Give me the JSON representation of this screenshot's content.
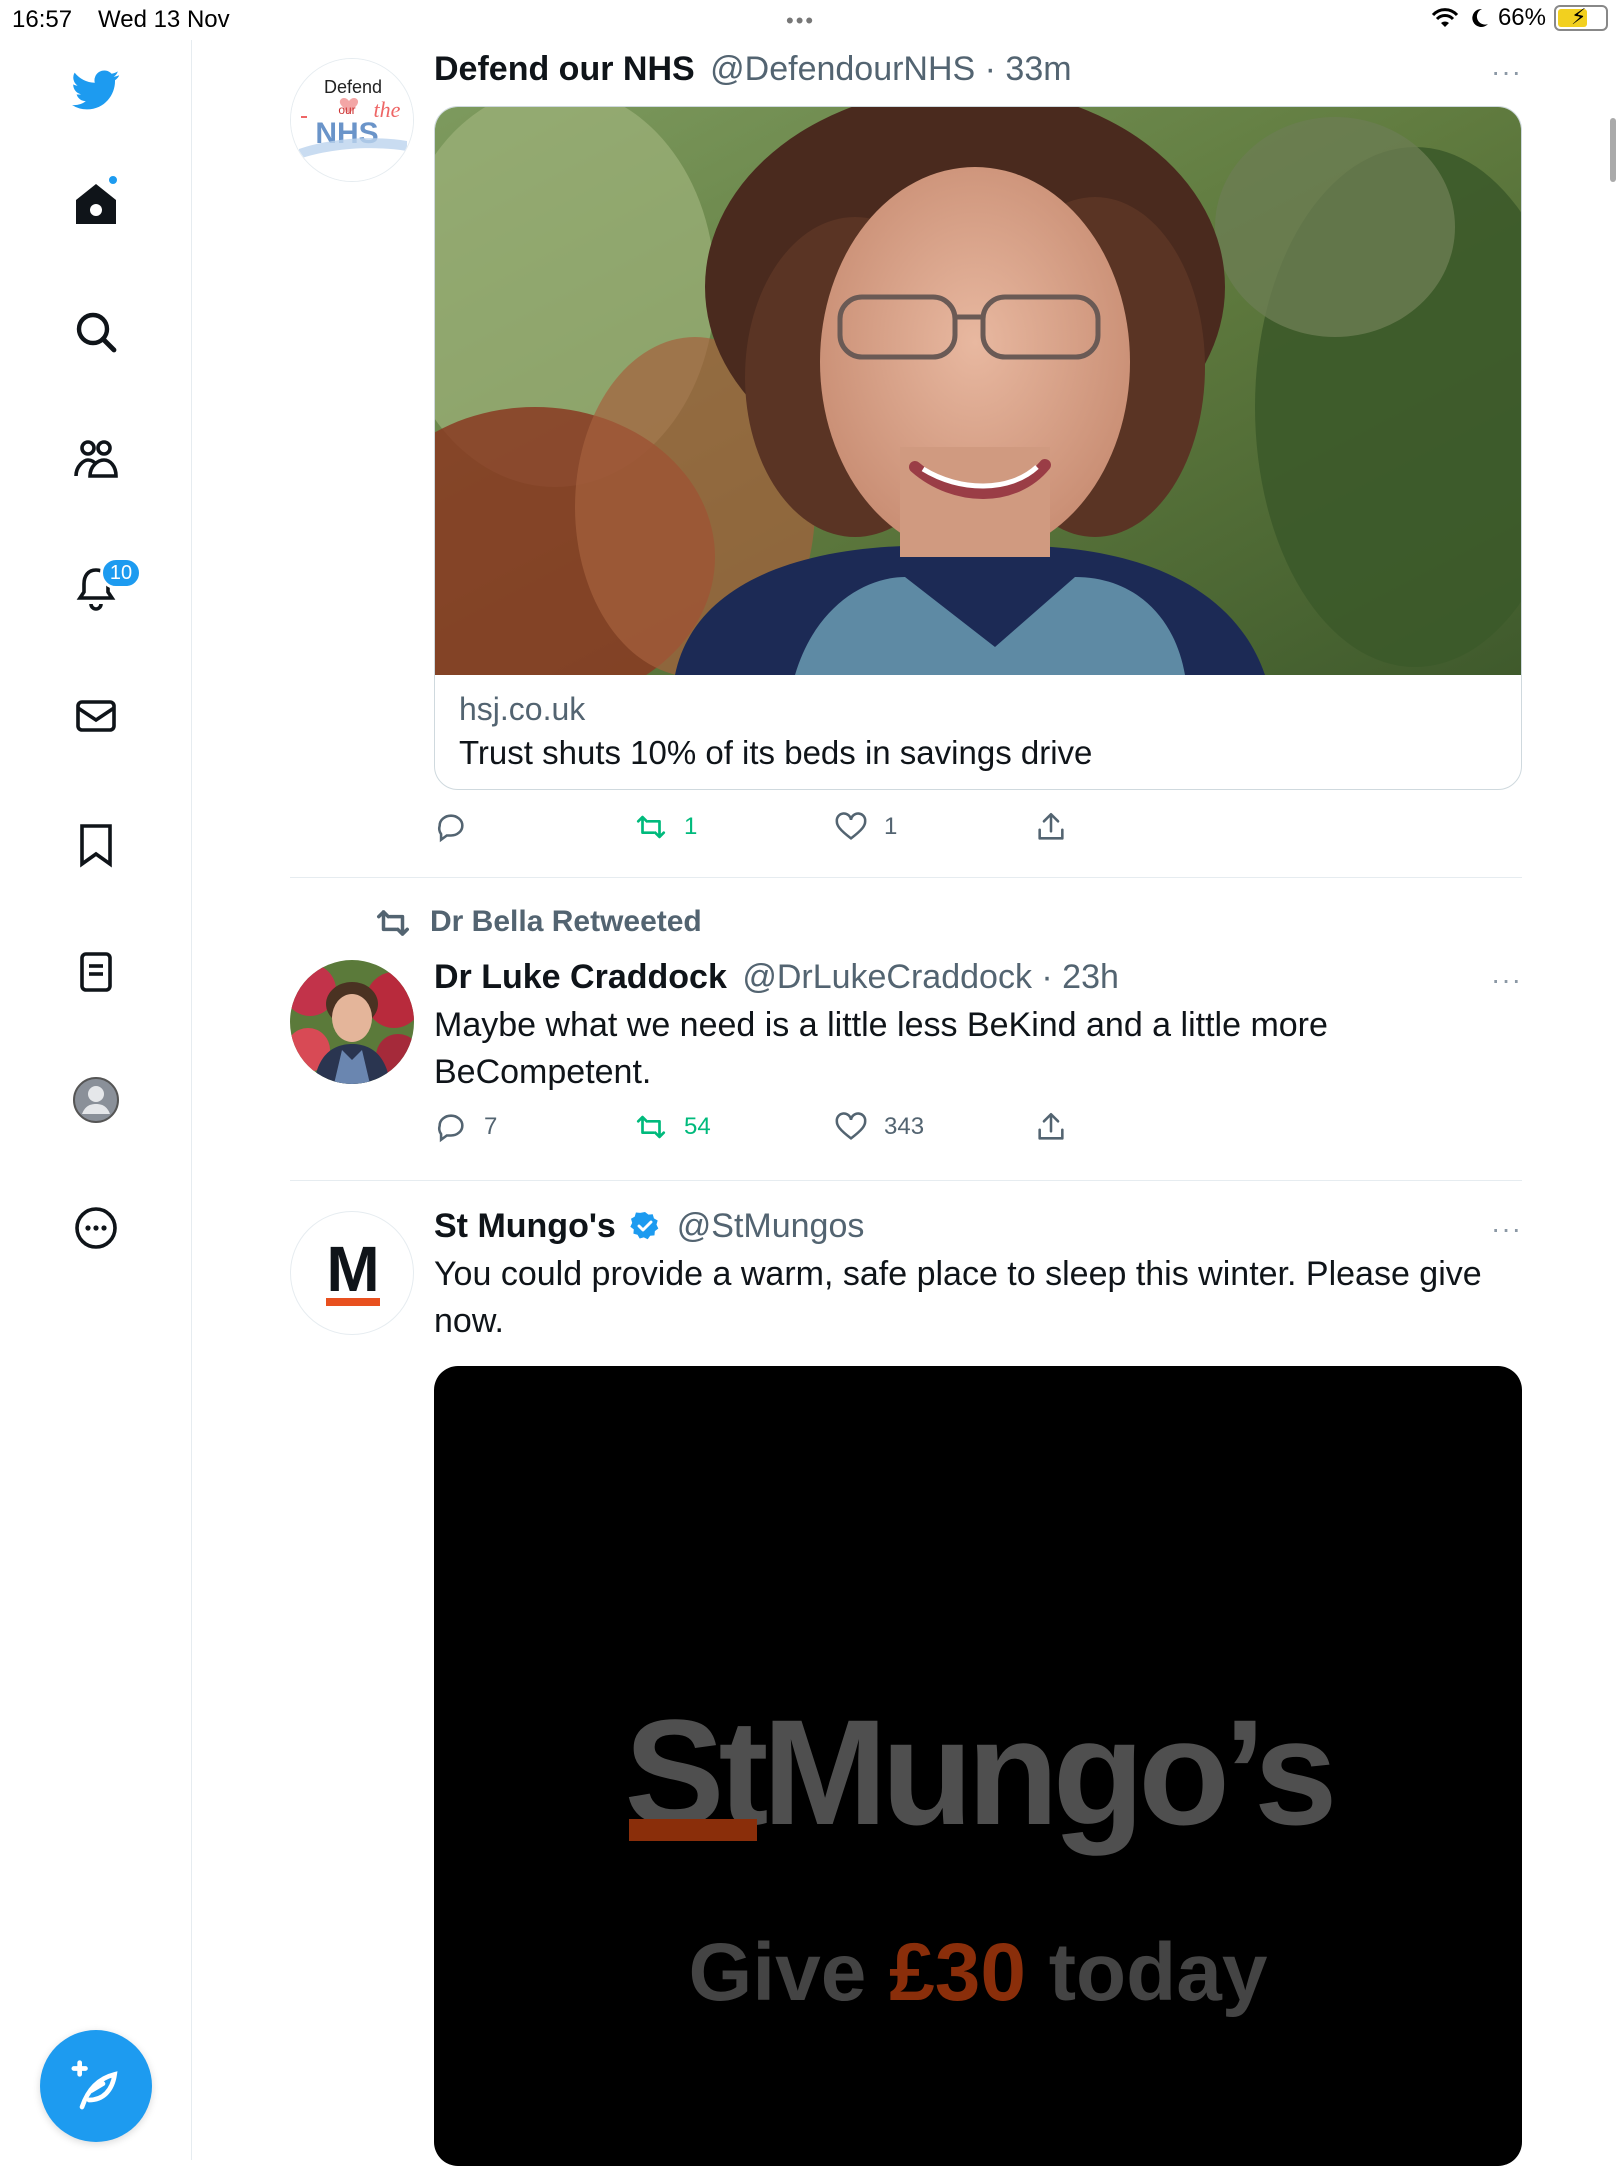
{
  "status": {
    "time": "16:57",
    "date": "Wed 13 Nov",
    "dots": "•••",
    "battery": "66%",
    "battery_level": 0.66
  },
  "sidebar": {
    "items": [
      {
        "name": "twitter-logo",
        "icon": "bird-icon"
      },
      {
        "name": "home",
        "icon": "home-icon"
      },
      {
        "name": "explore",
        "icon": "search-icon"
      },
      {
        "name": "communities",
        "icon": "people-icon"
      },
      {
        "name": "notifications",
        "icon": "bell-icon"
      },
      {
        "name": "messages",
        "icon": "mail-icon"
      },
      {
        "name": "bookmarks",
        "icon": "bookmark-icon"
      },
      {
        "name": "lists",
        "icon": "list-icon"
      },
      {
        "name": "profile",
        "icon": "avatar-icon"
      },
      {
        "name": "more",
        "icon": "more-circle-icon"
      }
    ],
    "notification_count": "10",
    "compose_icon": "compose-feather-icon"
  },
  "tweets": [
    {
      "avatar_text": {
        "line1": "Defend",
        "line2": "our",
        "line3": "the",
        "line4": "NHS"
      },
      "name": "Defend our NHS",
      "handle": "@DefendourNHS · 33m",
      "more": "···",
      "card": {
        "domain": "hsj.co.uk",
        "title": "Trust shuts 10% of its beds in savings drive"
      },
      "replies": "",
      "retweets": "1",
      "likes": "1"
    },
    {
      "retweeted_by": "Dr Bella Retweeted",
      "name": "Dr Luke Craddock",
      "handle": "@DrLukeCraddock · 23h",
      "more": "···",
      "text": "Maybe what we need is a little less BeKind and a little more BeCompetent.",
      "replies": "7",
      "retweets": "54",
      "likes": "343"
    },
    {
      "avatar_text": "M",
      "name": "St Mungo's",
      "verified": true,
      "handle": "@StMungos",
      "more": "···",
      "text": "You could provide a warm, safe place to sleep this winter. Please give now.",
      "media": {
        "brand_st": "St",
        "brand_rest": "Mungo’s",
        "give": "Give",
        "amount": "£30",
        "today": "today"
      }
    }
  ],
  "colors": {
    "accent": "#1d9bf0",
    "retweet": "#00ba7c",
    "secondary_text": "#536471",
    "mungo_orange": "#c2410c"
  }
}
